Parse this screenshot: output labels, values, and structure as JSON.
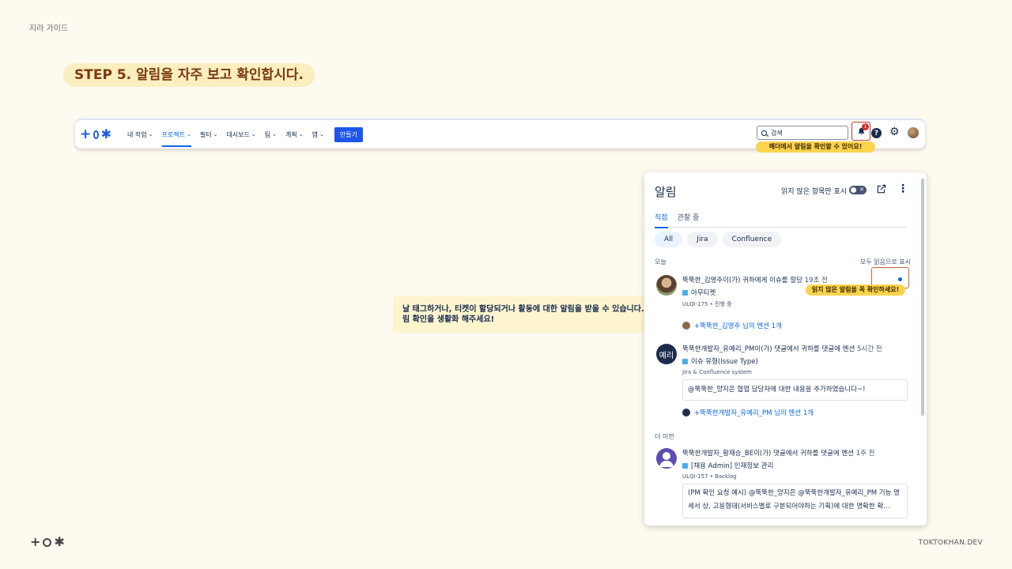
{
  "guide_label": "지라 가이드",
  "step_title": "STEP 5. 알림을 자주 보고 확인합시다.",
  "navbar": {
    "items": [
      {
        "label": "내 작업"
      },
      {
        "label": "프로젝트"
      },
      {
        "label": "필터"
      },
      {
        "label": "대시보드"
      },
      {
        "label": "팀"
      },
      {
        "label": "계획"
      },
      {
        "label": "앱"
      }
    ],
    "create_label": "만들기",
    "search_placeholder": "검색",
    "notification_count": "1",
    "help_glyph": "?"
  },
  "tips": {
    "header": "헤더에서 알림을 확인할 수 있어요!",
    "unread": "읽지 않은 알림을 꼭 확인하세요!"
  },
  "callout": "날 태그하거나, 티켓이 할당되거나 활동에 대한 알림을 받을 수 있습니다. 알림 확인을 생활화 해주세요!",
  "panel": {
    "title": "알림",
    "unread_only_label": "읽지 않은 항목만 표시",
    "tabs": [
      {
        "label": "직접"
      },
      {
        "label": "관찰 중"
      }
    ],
    "chips": [
      {
        "label": "All"
      },
      {
        "label": "Jira"
      },
      {
        "label": "Confluence"
      }
    ],
    "section_today": "오늘",
    "mark_all_read": "모두 읽음으로 표시",
    "section_older": "더 이전",
    "notifications": [
      {
        "line1": "뚝뚝한_김영주이(가) 귀하에게 이슈를 할당",
        "time": "19초 전",
        "issue": "아무티켓",
        "meta": "ULQI-175 • 진행 중",
        "mention": "+뚝뚝한_김영주 님의 멘션 1개"
      },
      {
        "avatar_text": "예리",
        "line1": "뚝뚝한개발자_유예리_PM이(가) 댓글에서 귀하를 댓글에 멘션",
        "time": "5시간 전",
        "issue": "이슈 유형(Issue Type)",
        "meta": "Jira & Confluence system",
        "quote": "@뚝뚝한_양지은 협업 담당자에 대한 내용을 추가하였습니다~!",
        "mention": "+뚝뚝한개발자_유예리_PM 님의 멘션 1개"
      },
      {
        "line1": "뚝뚝한개발자_황재승_BE이(가) 댓글에서 귀하를 댓글에 멘션",
        "time": "1주 전",
        "issue": "[채용 Admin] 인재정보 관리",
        "meta": "ULQI-157 • Backlog",
        "quote": "(PM 확인 요청 예시) @뚝뚝한_양지은 @뚝뚝한개발자_유예리_PM 기능 명세서 상, 고용형태(서비스별로 구분되어야하는 기획)에 대한 명확한 확..."
      }
    ]
  },
  "footer_site": "TOKTOKHAN.DEV",
  "colors": {
    "accent": "#1f55ea",
    "link": "#0c66e4",
    "tip": "#fcd34d",
    "step_bg": "#fbeec0",
    "step_text": "#7a3a0e"
  }
}
